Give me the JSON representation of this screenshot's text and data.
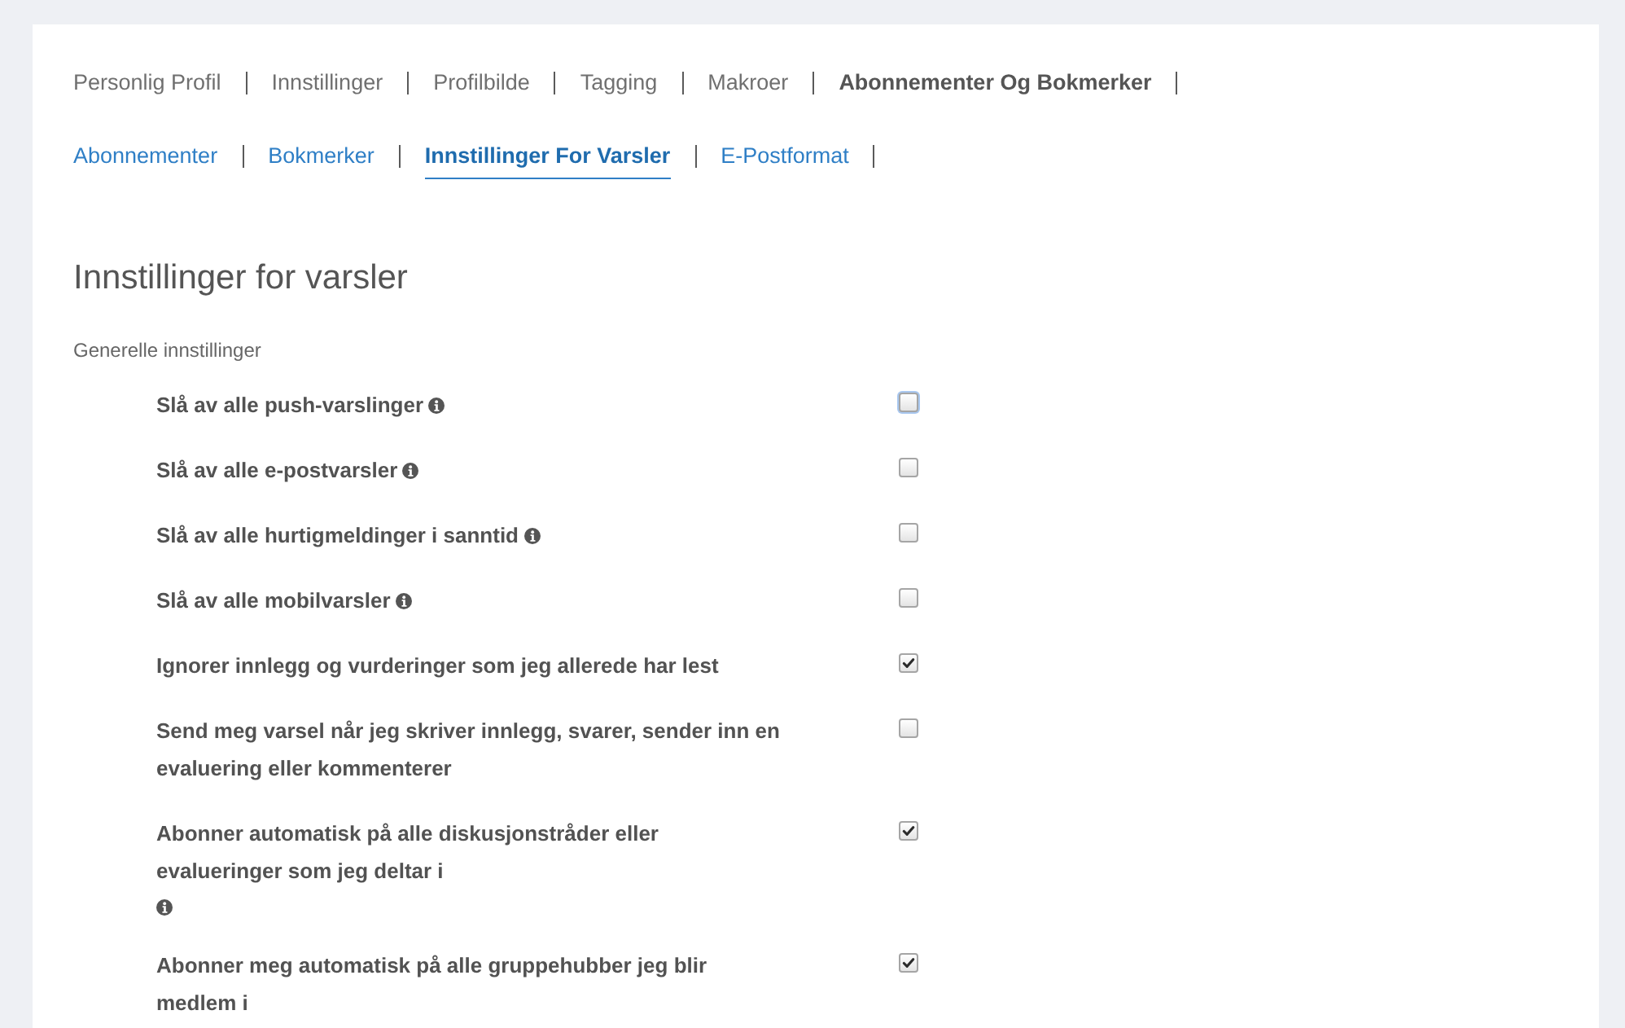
{
  "primary_nav": [
    {
      "label": "Personlig Profil",
      "selected": false
    },
    {
      "label": "Innstillinger",
      "selected": false
    },
    {
      "label": "Profilbilde",
      "selected": false
    },
    {
      "label": "Tagging",
      "selected": false
    },
    {
      "label": "Makroer",
      "selected": false
    },
    {
      "label": "Abonnementer Og Bokmerker",
      "selected": true
    }
  ],
  "secondary_nav": [
    {
      "label": "Abonnementer",
      "selected": false
    },
    {
      "label": "Bokmerker",
      "selected": false
    },
    {
      "label": "Innstillinger For Varsler",
      "selected": true
    },
    {
      "label": "E-Postformat",
      "selected": false
    }
  ],
  "section": {
    "title": "Innstillinger for varsler",
    "subtitle": "Generelle innstillinger"
  },
  "settings": [
    {
      "label": "Slå av alle push-varslinger",
      "info": true,
      "info_below": false,
      "checked": false,
      "focused": true
    },
    {
      "label": "Slå av alle e-postvarsler",
      "info": true,
      "info_below": false,
      "checked": false,
      "focused": false
    },
    {
      "label": "Slå av alle hurtigmeldinger i sanntid",
      "info": true,
      "info_below": false,
      "checked": false,
      "focused": false
    },
    {
      "label": "Slå av alle mobilvarsler",
      "info": true,
      "info_below": false,
      "checked": false,
      "focused": false
    },
    {
      "label": "Ignorer innlegg og vurderinger som jeg allerede har lest",
      "checked": true,
      "focused": false
    },
    {
      "label": "Send meg varsel når jeg skriver innlegg, svarer, sender inn en evaluering eller kommenterer",
      "checked": false,
      "focused": false
    },
    {
      "label": "Abonner automatisk på alle diskusjonstråder eller evalueringer som jeg deltar i",
      "info": true,
      "info_below": true,
      "checked": true,
      "focused": false
    },
    {
      "label": "Abonner meg automatisk på alle gruppehubber jeg blir medlem i",
      "checked": true,
      "focused": false
    }
  ]
}
